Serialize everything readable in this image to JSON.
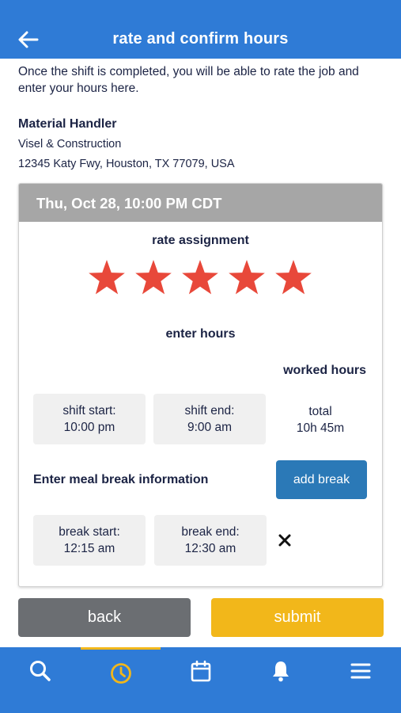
{
  "header": {
    "title": "rate and confirm hours"
  },
  "intro": "Once the shift is completed, you will be able to rate the job and enter your hours here.",
  "job": {
    "title": "Material Handler",
    "company": "Visel & Construction",
    "address": "12345 Katy Fwy, Houston, TX 77079, USA"
  },
  "card": {
    "date_header": "Thu, Oct 28, 10:00 PM CDT",
    "rate_label": "rate assignment",
    "rating": {
      "value": 5,
      "max": 5
    },
    "enter_hours_label": "enter hours",
    "worked_hours_label": "worked hours",
    "shift_start": {
      "label": "shift start:",
      "value": "10:00 pm"
    },
    "shift_end": {
      "label": "shift end:",
      "value": "9:00 am"
    },
    "total": {
      "label": "total",
      "value": "10h 45m"
    },
    "meal_label": "Enter meal break information",
    "add_break_label": "add break",
    "break_start": {
      "label": "break start:",
      "value": "12:15 am"
    },
    "break_end": {
      "label": "break end:",
      "value": "12:30 am"
    }
  },
  "actions": {
    "back_label": "back",
    "submit_label": "submit"
  },
  "tabs": [
    {
      "name": "search",
      "icon": "search-icon",
      "active": false
    },
    {
      "name": "history",
      "icon": "clock-icon",
      "active": true
    },
    {
      "name": "calendar",
      "icon": "calendar-icon",
      "active": false
    },
    {
      "name": "notifications",
      "icon": "bell-icon",
      "active": false
    },
    {
      "name": "menu",
      "icon": "menu-icon",
      "active": false
    }
  ],
  "colors": {
    "primary": "#2f7bd6",
    "star": "#e8483a",
    "accent": "#f2b71a",
    "add_break": "#2b79b7",
    "back_button": "#6b6e72",
    "card_header": "#a6a6a6"
  }
}
